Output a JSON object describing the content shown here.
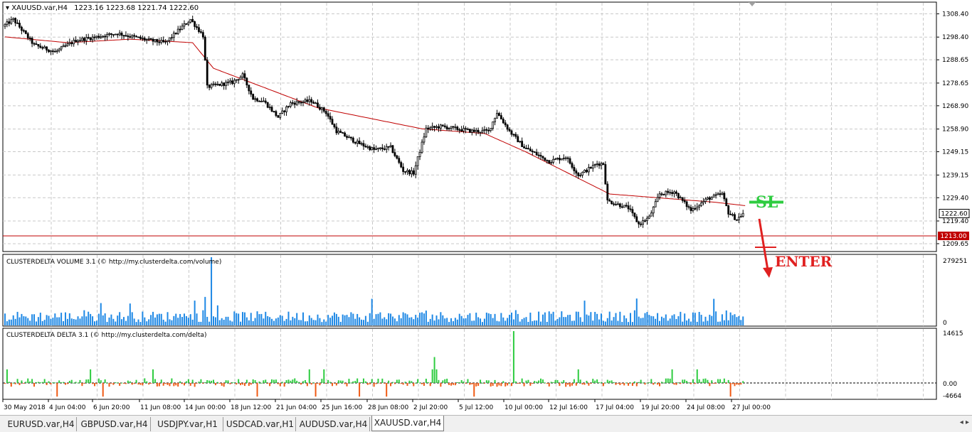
{
  "window": {
    "symbol_header": "XAUUSD.var,H4",
    "ohlc_header": "1223.16 1223.68 1221.74 1222.60"
  },
  "tabs": [
    {
      "label": "EURUSD.var,H4",
      "active": false
    },
    {
      "label": "GBPUSD.var,H4",
      "active": false
    },
    {
      "label": "USDJPY.var,H1",
      "active": false
    },
    {
      "label": "USDCAD.var,H1",
      "active": false
    },
    {
      "label": "AUDUSD.var,H4",
      "active": false
    },
    {
      "label": "XAUUSD.var,H4",
      "active": true
    }
  ],
  "colors": {
    "candle": "#000000",
    "moving_average": "#c00000",
    "volume_bar": "#1e88e5",
    "delta_positive": "#2ecc40",
    "delta_negative": "#f05a14",
    "sl_line": "#2ecc40",
    "enter_arrow": "#e02020",
    "level_line": "#c00000",
    "grid": "#c8c8c8"
  },
  "chart_data": [
    {
      "type": "candlestick",
      "title": "XAUUSD.var,H4",
      "price_axis_ticks": [
        "1308.40",
        "1298.40",
        "1288.65",
        "1278.65",
        "1268.90",
        "1258.90",
        "1249.15",
        "1239.15",
        "1229.40",
        "1219.40",
        "1209.65"
      ],
      "ylim": [
        1207.5,
        1312.5
      ],
      "current_price_label": "1222.60",
      "level_label": "1213.00",
      "level_value": 1213.0,
      "moving_average_anchors": [
        [
          0,
          1298.5
        ],
        [
          30,
          1296
        ],
        [
          60,
          1297.5
        ],
        [
          90,
          1296
        ],
        [
          100,
          1285
        ],
        [
          150,
          1268
        ],
        [
          200,
          1259
        ],
        [
          230,
          1257
        ],
        [
          250,
          1249
        ],
        [
          290,
          1231
        ],
        [
          340,
          1227.5
        ],
        [
          355,
          1226
        ]
      ],
      "candle_count": 355,
      "price_anchors": [
        [
          0,
          1303
        ],
        [
          5,
          1306
        ],
        [
          15,
          1295
        ],
        [
          25,
          1292
        ],
        [
          35,
          1297
        ],
        [
          55,
          1300
        ],
        [
          70,
          1297
        ],
        [
          78,
          1296
        ],
        [
          85,
          1302
        ],
        [
          90,
          1306
        ],
        [
          96,
          1299
        ],
        [
          98,
          1277
        ],
        [
          110,
          1279
        ],
        [
          115,
          1282
        ],
        [
          120,
          1272
        ],
        [
          125,
          1271
        ],
        [
          132,
          1264
        ],
        [
          138,
          1270
        ],
        [
          148,
          1271
        ],
        [
          155,
          1266
        ],
        [
          160,
          1258
        ],
        [
          170,
          1253
        ],
        [
          178,
          1250
        ],
        [
          186,
          1251
        ],
        [
          192,
          1241
        ],
        [
          197,
          1240
        ],
        [
          203,
          1259
        ],
        [
          210,
          1260
        ],
        [
          225,
          1258
        ],
        [
          233,
          1258
        ],
        [
          237,
          1266
        ],
        [
          243,
          1258
        ],
        [
          250,
          1251
        ],
        [
          256,
          1248
        ],
        [
          262,
          1245
        ],
        [
          270,
          1247
        ],
        [
          276,
          1239
        ],
        [
          285,
          1244
        ],
        [
          288,
          1244
        ],
        [
          290,
          1228
        ],
        [
          300,
          1225
        ],
        [
          305,
          1218
        ],
        [
          310,
          1221
        ],
        [
          315,
          1231
        ],
        [
          322,
          1232
        ],
        [
          330,
          1224
        ],
        [
          338,
          1229
        ],
        [
          345,
          1231
        ],
        [
          348,
          1223
        ],
        [
          352,
          1220
        ],
        [
          355,
          1222.6
        ]
      ],
      "sl_label": "SL",
      "sl_price": 1227.5,
      "enter_label": "ENTER",
      "x_tick_labels": [
        "30 May 2018",
        "4 Jun 04:00",
        "6 Jun 20:00",
        "11 Jun 08:00",
        "14 Jun 00:00",
        "18 Jun 12:00",
        "21 Jun 04:00",
        "25 Jun 16:00",
        "28 Jun 08:00",
        "2 Jul 20:00",
        "5 Jul 12:00",
        "10 Jul 00:00",
        "12 Jul 16:00",
        "17 Jul 04:00",
        "19 Jul 20:00",
        "24 Jul 08:00",
        "27 Jul 00:00"
      ]
    },
    {
      "type": "bar",
      "title": "CLUSTERDELTA VOLUME 3.1 (© http://my.clusterdelta.com/volume)",
      "axis_ticks": [
        "279251",
        "0"
      ],
      "ylim": [
        0,
        279251
      ],
      "typical_value": 40000,
      "peak_value": 279251
    },
    {
      "type": "bar",
      "title": "CLUSTERDELTA DELTA 3.1 (© http://my.clusterdelta.com/delta)",
      "axis_ticks": [
        "14615",
        "0.00",
        "-4664"
      ],
      "ylim": [
        -4664,
        14615
      ],
      "typical_value": 1200,
      "peak_value": 14615
    }
  ]
}
